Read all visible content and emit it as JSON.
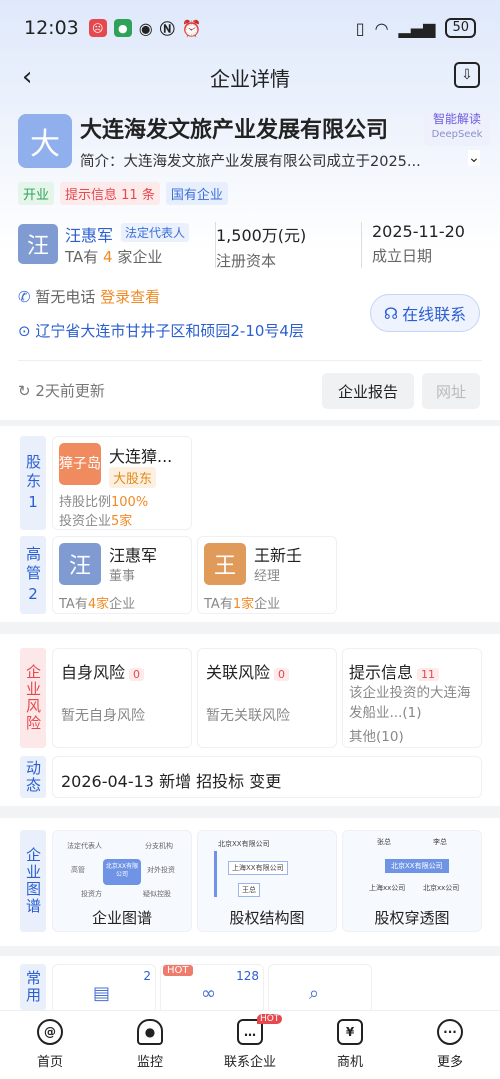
{
  "status": {
    "time": "12:03",
    "battery": "50",
    "icons": [
      "dnd-icon",
      "wechat-icon",
      "eye-icon",
      "nfc-icon",
      "alarm-icon"
    ],
    "right_icons": [
      "vibrate-icon",
      "wifi-icon",
      "signal-icon"
    ]
  },
  "nav": {
    "title": "企业详情"
  },
  "company": {
    "logo_char": "大",
    "name": "大连海发文旅产业发展有限公司",
    "ai_label": "智能解读",
    "ai_sub": "DeepSeek",
    "brief": "简介：大连海发文旅产业发展有限公司成立于2025..."
  },
  "tags": [
    "开业",
    "提示信息 11 条",
    "国有企业"
  ],
  "legal": {
    "avatar": "汪",
    "name": "汪惠军",
    "role": "法定代表人",
    "sub_pre": "TA有",
    "count": "4",
    "sub_post": "家企业"
  },
  "capital": {
    "value": "1,500万(元)",
    "label": "注册资本"
  },
  "founded": {
    "value": "2025-11-20",
    "label": "成立日期"
  },
  "contact": {
    "phone": "暂无电话",
    "login": "登录查看",
    "address": "辽宁省大连市甘井子区和硕园2-10号4层",
    "online": "在线联系"
  },
  "update": {
    "text": "2天前更新",
    "report": "企业报告",
    "website": "网址"
  },
  "shareholders": {
    "label": "股东",
    "count": "1",
    "item": {
      "avatar": "獐子岛",
      "name": "大连獐...",
      "badge": "大股东",
      "ratio_label": "持股比例",
      "ratio": "100%",
      "invest_label": "投资企业",
      "invest": "5家"
    }
  },
  "executives": {
    "label": "高管",
    "count": "2",
    "items": [
      {
        "avatar": "汪",
        "name": "汪惠军",
        "role": "董事",
        "pre": "TA有",
        "count": "4家",
        "post": "企业"
      },
      {
        "avatar": "王",
        "name": "王新壬",
        "role": "经理",
        "pre": "TA有",
        "count": "1家",
        "post": "企业"
      }
    ]
  },
  "risk": {
    "label": "企业风险",
    "items": [
      {
        "title": "自身风险",
        "count": "0",
        "desc": "暂无自身风险"
      },
      {
        "title": "关联风险",
        "count": "0",
        "desc": "暂无关联风险"
      },
      {
        "title": "提示信息",
        "count": "11",
        "desc": "该企业投资的大连海发船业...(1)",
        "desc2": "其他(10)"
      }
    ]
  },
  "dynamic": {
    "label": "动态",
    "text": "2026-04-13 新增 招投标 变更"
  },
  "graphs": {
    "label": "企业图谱",
    "items": [
      {
        "title": "企业图谱",
        "center": "北京XX有限公司",
        "nodes": [
          "法定代表人",
          "分支机构",
          "高管",
          "对外投资",
          "投资方",
          "疑似控股"
        ]
      },
      {
        "title": "股权结构图",
        "lines": [
          "北京XX有限公司",
          "上海XX有限公司",
          "王总"
        ]
      },
      {
        "title": "股权穿透图",
        "lines": [
          "张总",
          "李总",
          "北京XX有限公司",
          "上海xx公司",
          "北京xx公司"
        ]
      }
    ]
  },
  "common": {
    "label": "常用",
    "hot": "HOT",
    "n1": "2",
    "n2": "128"
  },
  "tabbar": [
    {
      "label": "首页",
      "icon": "home-icon"
    },
    {
      "label": "监控",
      "icon": "monitor-icon"
    },
    {
      "label": "联系企业",
      "icon": "contact-icon",
      "hot": "HOT"
    },
    {
      "label": "商机",
      "icon": "opportunity-icon"
    },
    {
      "label": "更多",
      "icon": "more-icon"
    }
  ]
}
